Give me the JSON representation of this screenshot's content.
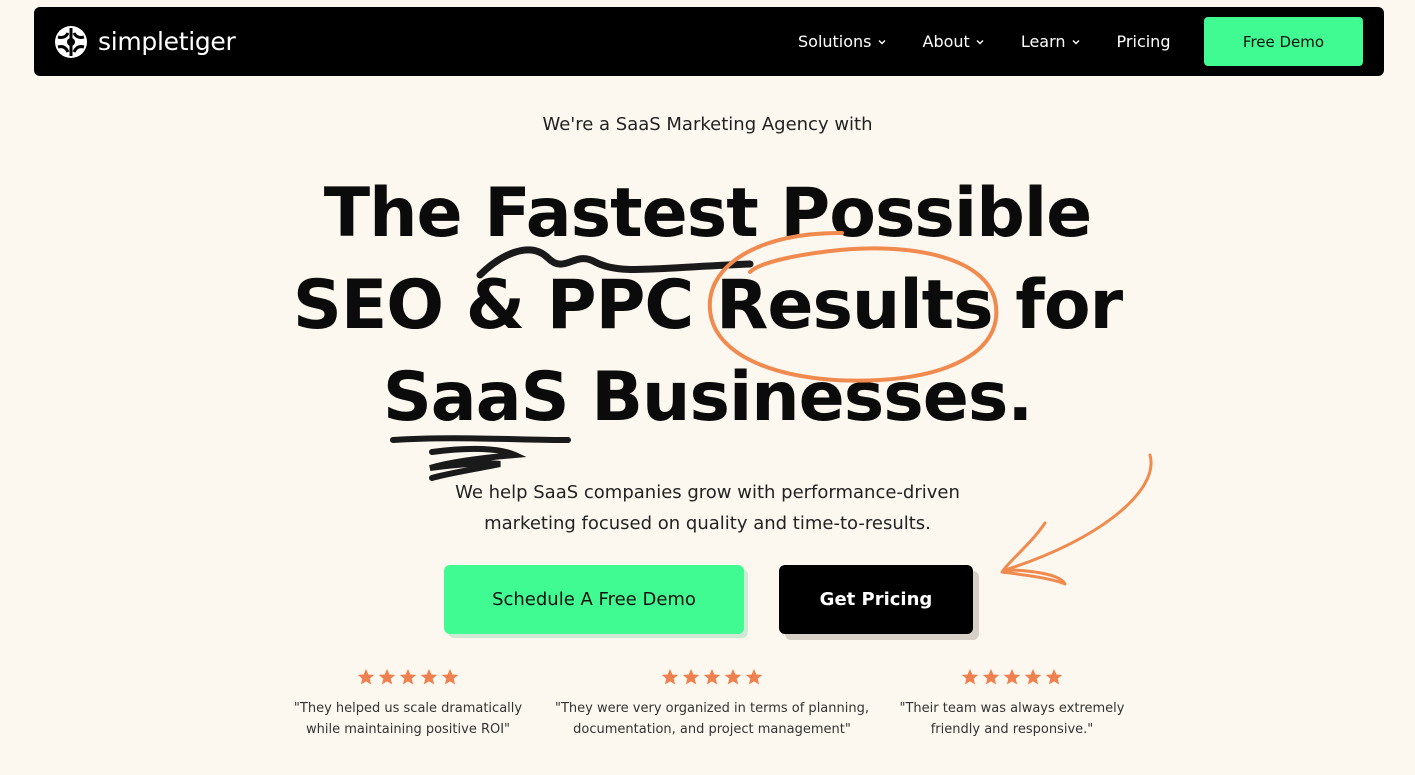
{
  "brand": {
    "name": "simpletiger",
    "logo_icon": "tiger-logo-icon"
  },
  "nav": {
    "items": [
      {
        "label": "Solutions",
        "has_dropdown": true
      },
      {
        "label": "About",
        "has_dropdown": true
      },
      {
        "label": "Learn",
        "has_dropdown": true
      },
      {
        "label": "Pricing",
        "has_dropdown": false
      }
    ],
    "cta_label": "Free Demo"
  },
  "hero": {
    "eyebrow": "We're a SaaS Marketing Agency with",
    "headline_lines": [
      "The Fastest Possible",
      "SEO & PPC Results for",
      "SaaS Businesses."
    ],
    "subtext_lines": [
      "We help SaaS companies grow with performance-driven",
      "marketing focused on quality and time-to-results."
    ],
    "primary_button": "Schedule A Free Demo",
    "secondary_button": "Get Pricing"
  },
  "reviews": [
    {
      "rating": 5,
      "quote_lines": [
        "\"They helped us scale dramatically",
        "while maintaining positive ROI\""
      ]
    },
    {
      "rating": 5,
      "quote_lines": [
        "\"They were very organized in terms of planning,",
        "documentation, and project management\""
      ]
    },
    {
      "rating": 5,
      "quote_lines": [
        "\"Their team was always extremely",
        "friendly and responsive.\""
      ]
    }
  ],
  "colors": {
    "background": "#fdf8ef",
    "accent_green": "#3ffb91",
    "accent_orange": "#f08a4f",
    "nav_bg": "#000000",
    "star": "#ef8150"
  }
}
